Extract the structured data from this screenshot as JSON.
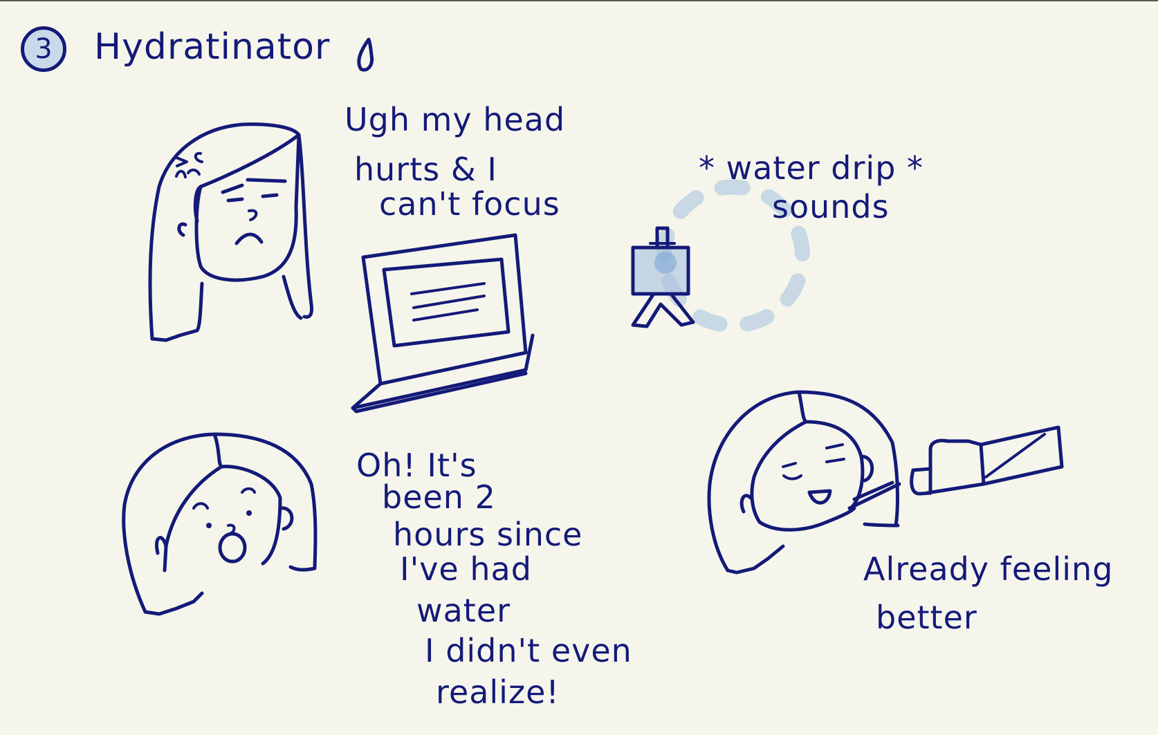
{
  "header": {
    "step_number": "3",
    "title": "Hydratinator"
  },
  "captions": {
    "headache_line1": "Ugh my head",
    "headache_line2": "hurts & I",
    "headache_line3": "can't focus",
    "sound_line1": "* water drip *",
    "sound_line2": "sounds",
    "realize_line1": "Oh! It's",
    "realize_line2": "been 2",
    "realize_line3": "hours since",
    "realize_line4": "I've had",
    "realize_line5": "water",
    "realize_line6": "I didn't even",
    "realize_line7": "realize!",
    "better_line1": "Already feeling",
    "better_line2": "better"
  },
  "colors": {
    "ink": "#141a78",
    "paper": "#f5f5ec",
    "water_blue": "#b8cde3",
    "badge_fill": "#c9d9ea"
  },
  "icons": [
    "water-drop-icon",
    "laptop-icon",
    "water-device-icon",
    "water-bottle-icon"
  ]
}
